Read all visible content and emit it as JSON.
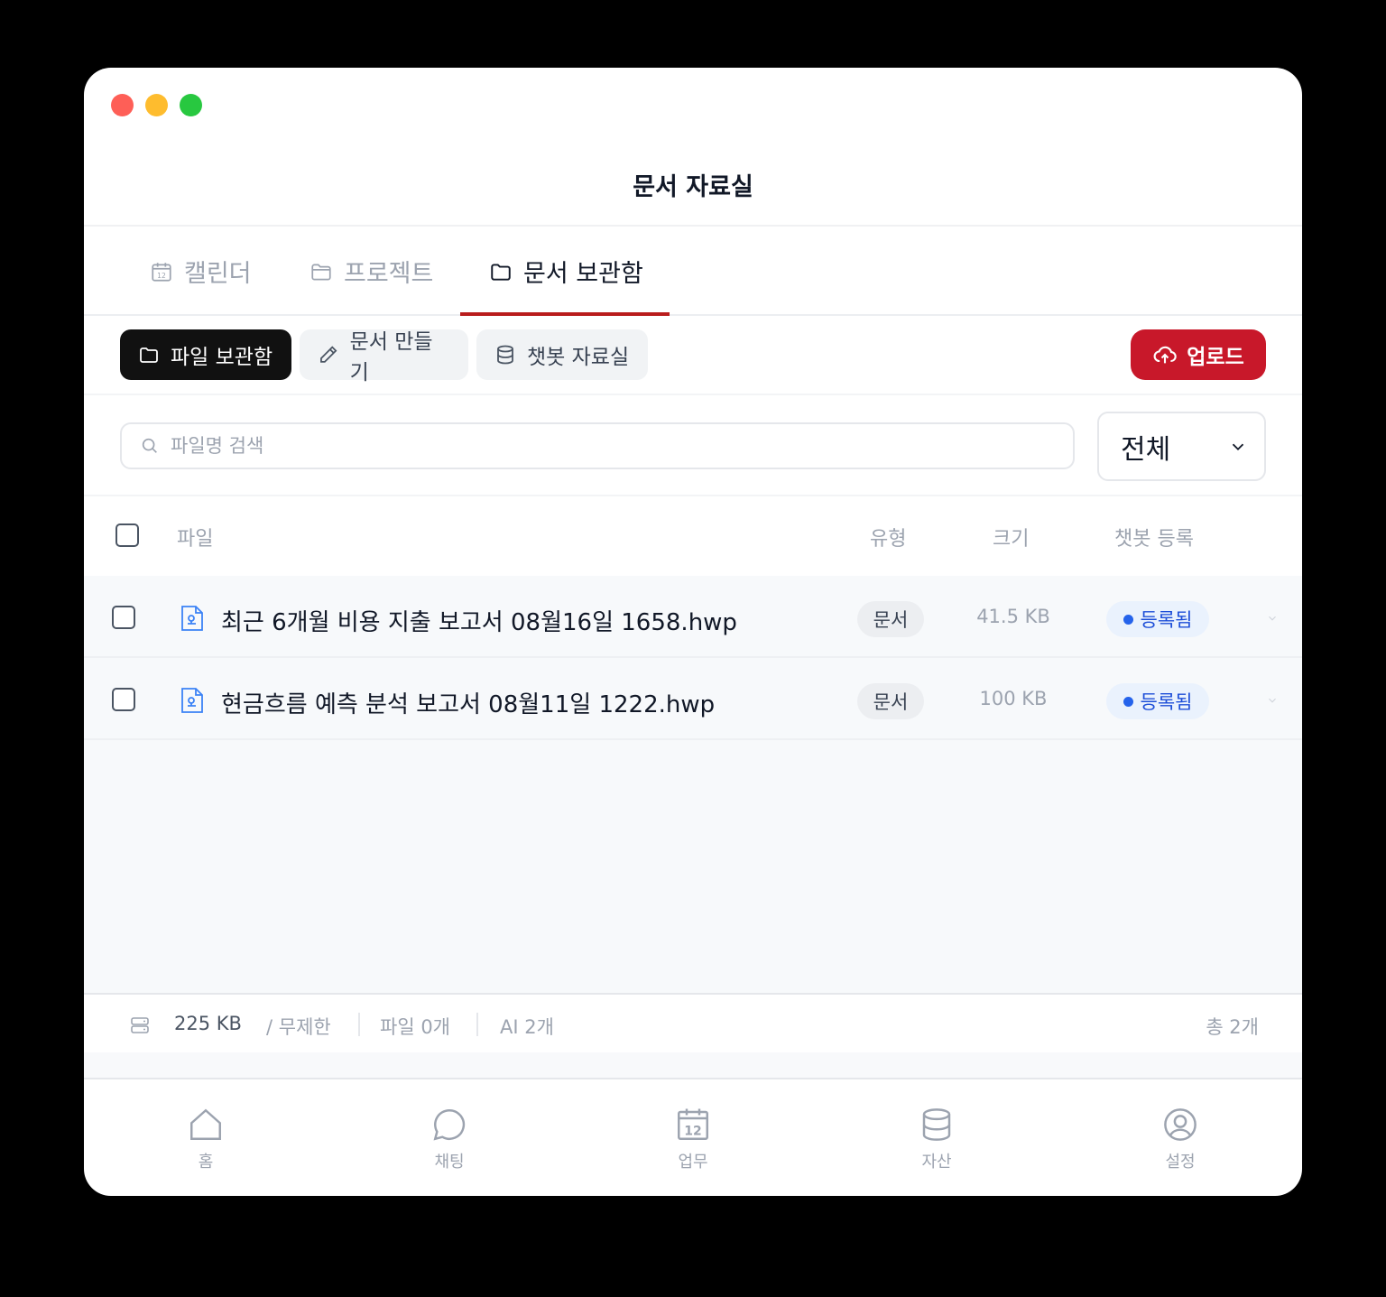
{
  "window": {
    "title": "문서 자료실"
  },
  "tabs": [
    {
      "label": "캘린더",
      "icon": "calendar-icon"
    },
    {
      "label": "프로젝트",
      "icon": "folder-icon"
    },
    {
      "label": "문서 보관함",
      "icon": "folder-icon",
      "active": true
    }
  ],
  "toolbar": {
    "segments": [
      {
        "label": "파일 보관함",
        "icon": "folder-icon",
        "active": true
      },
      {
        "label": "문서 만들기",
        "icon": "pencil-icon"
      },
      {
        "label": "챗봇 자료실",
        "icon": "database-icon"
      }
    ],
    "upload_label": "업로드"
  },
  "search": {
    "placeholder": "파일명 검색",
    "value": ""
  },
  "filter": {
    "selected": "전체"
  },
  "table": {
    "headers": {
      "file": "파일",
      "type": "유형",
      "size": "크기",
      "chatbot": "챗봇 등록"
    },
    "rows": [
      {
        "name": "최근 6개월 비용 지출 보고서 08월16일 1658.hwp",
        "type": "문서",
        "size": "41.5 KB",
        "status": "등록됨"
      },
      {
        "name": "현금흐름 예측 분석 보고서 08월11일 1222.hwp",
        "type": "문서",
        "size": "100 KB",
        "status": "등록됨"
      }
    ]
  },
  "footer": {
    "used": "225 KB",
    "quota": "/ 무제한",
    "files": "파일 0개",
    "ai": "AI 2개",
    "total": "총 2개"
  },
  "nav": [
    {
      "label": "홈",
      "icon": "home-icon"
    },
    {
      "label": "채팅",
      "icon": "chat-icon"
    },
    {
      "label": "업무",
      "icon": "calendar-icon"
    },
    {
      "label": "자산",
      "icon": "database-icon"
    },
    {
      "label": "설정",
      "icon": "user-circle-icon"
    }
  ],
  "colors": {
    "accent": "#c8182a",
    "tab_indicator": "#b91c1c",
    "status_blue": "#2563eb",
    "file_icon": "#3b82f6"
  }
}
